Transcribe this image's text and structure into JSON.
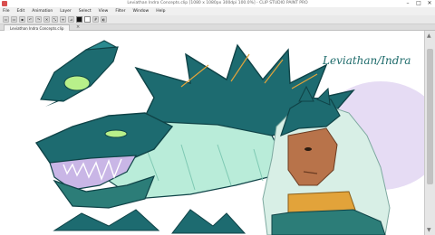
{
  "window": {
    "title": "Leviathan Indra Concepts.clip [1080 x 1080px 300dpi 100.0%] - CLIP STUDIO PAINT PRO",
    "controls": {
      "minimize": "–",
      "maximize": "□",
      "close": "✕"
    }
  },
  "menu": [
    "File",
    "Edit",
    "Animation",
    "Layer",
    "Select",
    "View",
    "Filter",
    "Window",
    "Help"
  ],
  "toolbar": {
    "icons": [
      "new-icon",
      "open-icon",
      "save-icon",
      "undo-icon",
      "redo-icon",
      "clear-icon",
      "transform-icon",
      "snap-icon",
      "ruler-icon",
      "color-swatch",
      "grid-icon",
      "mode-icon"
    ],
    "main_color": "#111111",
    "sub_color": "#ffffff"
  },
  "document_tab": {
    "label": "Leviathan Indra Concepts.clip",
    "close": "×"
  },
  "artwork": {
    "signature": "Leviathan/Indra",
    "colors": {
      "dragon_body": "#1d6b70",
      "dragon_dark": "#0f4347",
      "mint": "#b9ecd9",
      "lavender": "#c9b6e6",
      "skin": "#b8734a",
      "hair": "#d8efe6",
      "gold": "#e2a33a",
      "teal_shirt": "#2c7d78",
      "eye": "#b8f08a"
    }
  }
}
